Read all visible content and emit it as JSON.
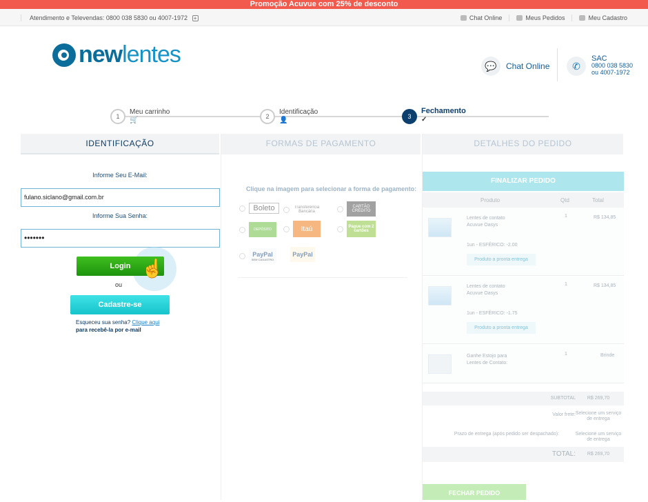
{
  "promo": "Promoção Acuvue com 25% de desconto",
  "topbar": {
    "phone_text": "Atendimento e Televendas: 0800 038 5830 ou 4007-1972",
    "links": [
      "Chat Online",
      "Meus Pedidos",
      "Meu Cadastro"
    ]
  },
  "logo": {
    "part1": "new",
    "part2": "lentes"
  },
  "header": {
    "chat_label": "Chat Online",
    "sac_title": "SAC",
    "sac_phone1": "0800 038 5830",
    "sac_phone2": "ou 4007-1972"
  },
  "steps": [
    {
      "num": "1",
      "label": "Meu carrinho"
    },
    {
      "num": "2",
      "label": "Identificação"
    },
    {
      "num": "3",
      "label": "Fechamento"
    }
  ],
  "identification": {
    "title": "IDENTIFICAÇÃO",
    "email_label": "Informe Seu E-Mail:",
    "email_value": "fulano.siclano@gmail.com.br",
    "password_label": "Informe Sua Senha:",
    "password_value": "•••••••",
    "login_button": "Login",
    "or_text": "ou",
    "register_button": "Cadastre-se",
    "forgot_text": "Esqueceu sua senha?",
    "forgot_link": "Clique aqui",
    "forgot_text2": "para recebê-la por e-mail"
  },
  "payment": {
    "title": "FORMAS DE PAGAMENTO",
    "instruction": "Clique na imagem para selecionar a forma de pagamento:",
    "options": [
      "Boleto",
      "Transferência Bancária",
      "CARTÃO CRÉDITO",
      "DEPÓSITO",
      "Itaú",
      "Pague com 2 cartões",
      "PayPal",
      "SEM CADASTRO",
      "PayPal"
    ]
  },
  "order": {
    "title": "DETALHES DO PEDIDO",
    "finalize_button": "FINALIZAR PEDIDO",
    "col_product": "Produto",
    "col_qty": "Qtd",
    "col_total": "Total",
    "items": [
      {
        "name1": "Lentes de contato",
        "name2": "Acuvue Oasys",
        "qty": "1",
        "price": "R$ 134,85",
        "spec": "1un - ESFÉRICO: -2.00",
        "pill": "Produto a pronta entrega"
      },
      {
        "name1": "Lentes de contato",
        "name2": "Acuvue Oasys",
        "qty": "1",
        "price": "R$ 134,85",
        "spec": "1un - ESFÉRICO: -1.75",
        "pill": "Produto a pronta entrega"
      },
      {
        "name1": "Ganhe Estojo para",
        "name2": "Lentes de Contato:",
        "qty": "1",
        "price": "Brinde"
      }
    ],
    "subtotal_label": "SUBTOTAL",
    "subtotal_value": "R$ 269,70",
    "freight_label": "Valor frete:",
    "freight_value": "Selecione um serviço de entrega",
    "delivery_label": "Prazo de entrega (após pedido ser despachado):",
    "delivery_value": "Selecione um serviço de entrega",
    "total_label": "TOTAL:",
    "total_value": "R$ 269,70",
    "close_button": "FECHAR PEDIDO"
  }
}
